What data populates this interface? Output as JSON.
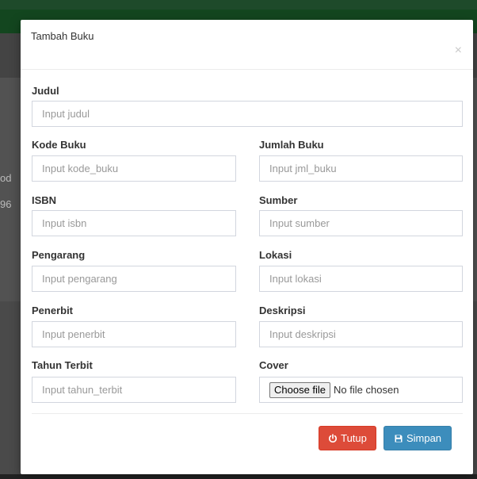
{
  "background": {
    "peek_1": "od",
    "peek_2": "96"
  },
  "modal": {
    "title": "Tambah Buku",
    "close_symbol": "×"
  },
  "fields": {
    "judul": {
      "label": "Judul",
      "placeholder": "Input judul"
    },
    "kode_buku": {
      "label": "Kode Buku",
      "placeholder": "Input kode_buku"
    },
    "jml_buku": {
      "label": "Jumlah Buku",
      "placeholder": "Input jml_buku"
    },
    "isbn": {
      "label": "ISBN",
      "placeholder": "Input isbn"
    },
    "sumber": {
      "label": "Sumber",
      "placeholder": "Input sumber"
    },
    "pengarang": {
      "label": "Pengarang",
      "placeholder": "Input pengarang"
    },
    "lokasi": {
      "label": "Lokasi",
      "placeholder": "Input lokasi"
    },
    "penerbit": {
      "label": "Penerbit",
      "placeholder": "Input penerbit"
    },
    "deskripsi": {
      "label": "Deskripsi",
      "placeholder": "Input deskripsi"
    },
    "tahun_terbit": {
      "label": "Tahun Terbit",
      "placeholder": "Input tahun_terbit"
    },
    "cover": {
      "label": "Cover",
      "button_label": "Choose file",
      "status": "No file chosen"
    }
  },
  "footer": {
    "close_label": "Tutup",
    "save_label": "Simpan"
  },
  "colors": {
    "danger": "#dd4b39",
    "primary": "#3c8dbc",
    "header_green": "#13461f"
  },
  "icons": {
    "close_button_icon": "power-icon",
    "save_button_icon": "floppy-disk-icon"
  }
}
